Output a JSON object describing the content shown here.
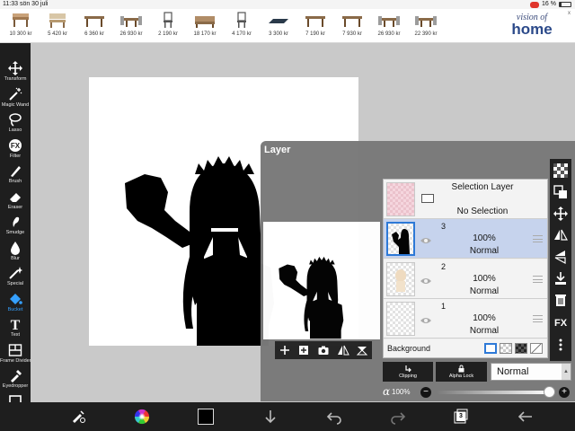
{
  "status": {
    "time": "11:33",
    "date": "sön 30 juli",
    "battery": "16 %"
  },
  "ad": {
    "items": [
      {
        "price": "10 300 kr",
        "icon": "patio-furniture-icon"
      },
      {
        "price": "5 420 kr",
        "icon": "bench-icon"
      },
      {
        "price": "6 360 kr",
        "icon": "table-icon"
      },
      {
        "price": "26 930 kr",
        "icon": "dining-set-icon"
      },
      {
        "price": "2 190 kr",
        "icon": "chair-icon"
      },
      {
        "price": "18 170 kr",
        "icon": "sofa-set-icon"
      },
      {
        "price": "4 170 kr",
        "icon": "chair-icon"
      },
      {
        "price": "3 300 kr",
        "icon": "mat-icon"
      },
      {
        "price": "7 190 kr",
        "icon": "table-icon"
      },
      {
        "price": "7 930 kr",
        "icon": "table-icon"
      },
      {
        "price": "26 930 kr",
        "icon": "dining-set-icon"
      },
      {
        "price": "22 390 kr",
        "icon": "dining-set-icon"
      }
    ],
    "brand_line1": "vision of",
    "brand_line2": "home",
    "close": "x"
  },
  "tools": [
    {
      "label": "Transform",
      "icon": "transform-icon"
    },
    {
      "label": "Magic Wand",
      "icon": "magic-wand-icon"
    },
    {
      "label": "Lasso",
      "icon": "lasso-icon"
    },
    {
      "label": "Filter",
      "icon": "fx-filter-icon",
      "glyph": "FX"
    },
    {
      "label": "Brush",
      "icon": "brush-icon"
    },
    {
      "label": "Eraser",
      "icon": "eraser-icon"
    },
    {
      "label": "Smudge",
      "icon": "smudge-icon"
    },
    {
      "label": "Blur",
      "icon": "blur-drop-icon"
    },
    {
      "label": "Special",
      "icon": "special-icon"
    },
    {
      "label": "Bucket",
      "icon": "bucket-icon",
      "active": true
    },
    {
      "label": "Text",
      "icon": "text-icon",
      "glyph": "T"
    },
    {
      "label": "Frame Divider",
      "icon": "frame-divider-icon"
    },
    {
      "label": "Eyedropper",
      "icon": "eyedropper-icon"
    },
    {
      "label": "Canvas",
      "icon": "canvas-icon"
    }
  ],
  "layer_panel": {
    "title": "Layer",
    "selection_layer": {
      "title": "Selection Layer",
      "status": "No Selection"
    },
    "layers": [
      {
        "number": "3",
        "opacity": "100%",
        "mode": "Normal",
        "selected": true
      },
      {
        "number": "2",
        "opacity": "100%",
        "mode": "Normal",
        "selected": false
      },
      {
        "number": "1",
        "opacity": "100%",
        "mode": "Normal",
        "selected": false
      }
    ],
    "background_label": "Background",
    "clipping_label": "Clipping",
    "alpha_lock_label": "Alpha Lock",
    "blend_mode": "Normal",
    "alpha_symbol": "α",
    "alpha_value": "100%",
    "alpha_fraction": 1.0,
    "minus": "−",
    "plus": "+",
    "fx_label": "FX"
  },
  "bottom": {
    "layer_count": "3",
    "color": "#000000"
  }
}
